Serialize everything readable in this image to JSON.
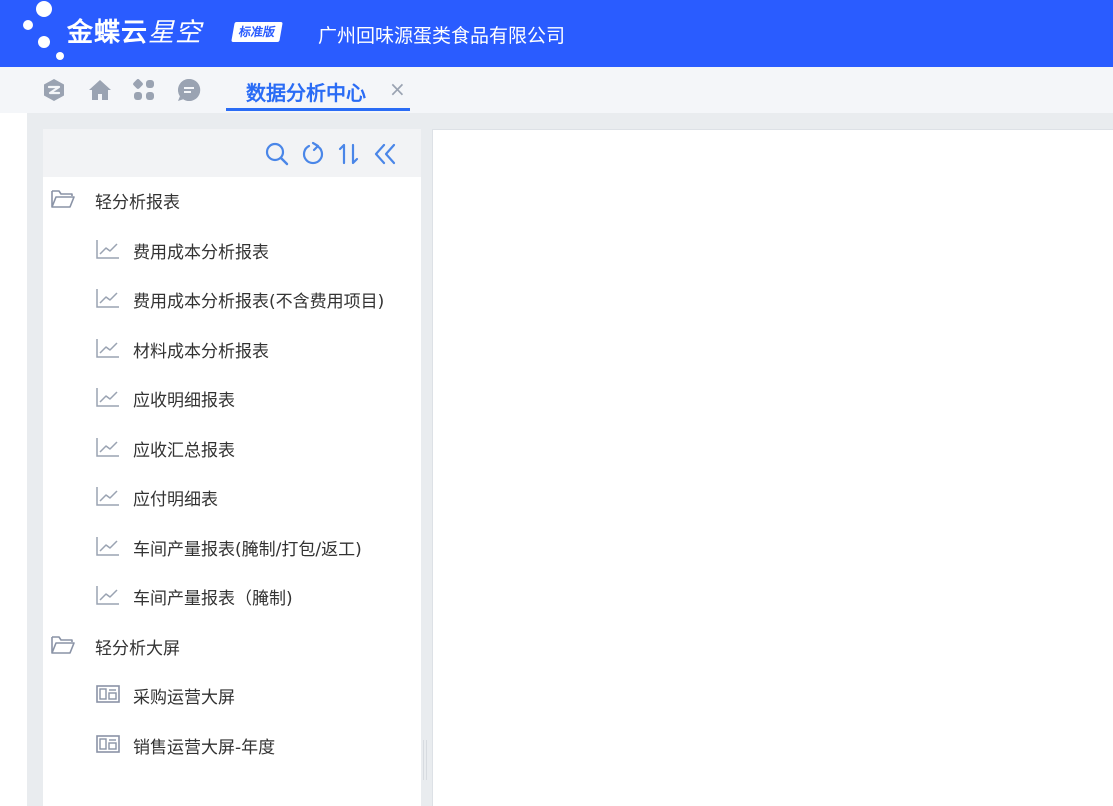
{
  "header": {
    "logo_main": "金蝶云",
    "logo_sub": "星空",
    "edition_badge": "标准版",
    "company_name": "广州回味源蛋类食品有限公司"
  },
  "tabbar": {
    "icons": [
      "app-switch-icon",
      "home-icon",
      "apps-grid-icon",
      "message-icon"
    ],
    "active_tab": {
      "label": "数据分析中心",
      "close": "×"
    }
  },
  "tree_toolbar": {
    "icons": [
      "search-icon",
      "refresh-icon",
      "sort-icon",
      "collapse-icon"
    ]
  },
  "tree": {
    "groups": [
      {
        "label": "轻分析报表",
        "icon": "folder-icon",
        "items": [
          "费用成本分析报表",
          "费用成本分析报表(不含费用项目)",
          "材料成本分析报表",
          "应收明细报表",
          "应收汇总报表",
          "应付明细表",
          "车间产量报表(腌制/打包/返工)",
          "车间产量报表（腌制)"
        ],
        "item_icon": "line-chart-icon"
      },
      {
        "label": "轻分析大屏",
        "icon": "folder-icon",
        "items": [
          "采购运营大屏",
          "销售运营大屏-年度"
        ],
        "item_icon": "dashboard-icon"
      }
    ]
  },
  "colors": {
    "header_bg": "#2a5cff",
    "tab_accent": "#2a6cf5",
    "icon_gray": "#9aa3b2",
    "toolbar_icon_blue": "#4a86e8"
  }
}
